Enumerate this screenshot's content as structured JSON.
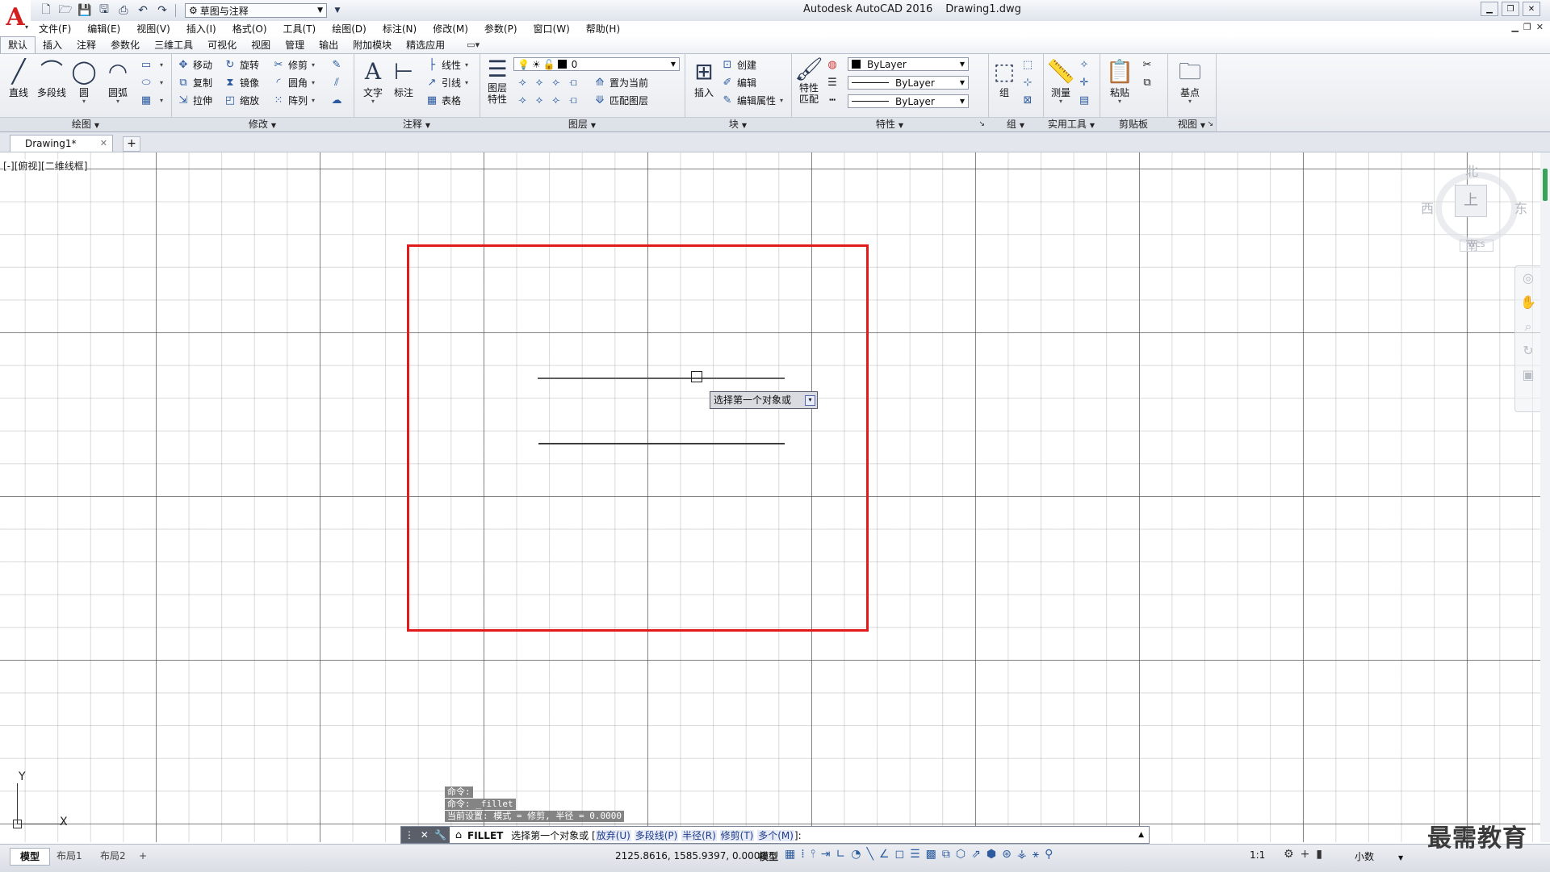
{
  "window": {
    "app_title": "Autodesk AutoCAD 2016",
    "file_title": "Drawing1.dwg"
  },
  "quick_access": {
    "workspace": "草图与注释"
  },
  "menu": [
    "文件(F)",
    "编辑(E)",
    "视图(V)",
    "插入(I)",
    "格式(O)",
    "工具(T)",
    "绘图(D)",
    "标注(N)",
    "修改(M)",
    "参数(P)",
    "窗口(W)",
    "帮助(H)"
  ],
  "ribbon_tabs": [
    "默认",
    "插入",
    "注释",
    "参数化",
    "三维工具",
    "可视化",
    "视图",
    "管理",
    "输出",
    "附加模块",
    "精选应用"
  ],
  "ribbon": {
    "draw": {
      "title": "绘图",
      "line": "直线",
      "polyline": "多段线",
      "circle": "圆",
      "arc": "圆弧"
    },
    "modify": {
      "title": "修改",
      "move": "移动",
      "rotate": "旋转",
      "trim": "修剪",
      "copy": "复制",
      "mirror": "镜像",
      "fillet": "圆角",
      "stretch": "拉伸",
      "scale": "缩放",
      "array": "阵列"
    },
    "annotation": {
      "title": "注释",
      "text": "文字",
      "dimension": "标注",
      "linear": "线性",
      "leader": "引线",
      "table": "表格"
    },
    "layers": {
      "title": "图层",
      "layer_props": "图层",
      "layer_props2": "特性",
      "current_layer": "0",
      "set_current": "置为当前",
      "match_layer": "匹配图层"
    },
    "block": {
      "title": "块",
      "insert": "插入",
      "create": "创建",
      "edit": "编辑",
      "edit_attr": "编辑属性"
    },
    "properties": {
      "title": "特性",
      "match": "特性",
      "match2": "匹配",
      "color": "ByLayer",
      "linetype": "ByLayer",
      "lineweight": "ByLayer"
    },
    "groups": {
      "title": "组",
      "group": "组"
    },
    "utilities": {
      "title": "实用工具",
      "measure": "测量"
    },
    "clipboard": {
      "title": "剪贴板",
      "paste": "粘贴"
    },
    "view": {
      "title": "视图",
      "base": "基点"
    }
  },
  "file_tabs": {
    "doc": "Drawing1*"
  },
  "viewport": {
    "label": "[-][俯视][二维线框]",
    "tooltip": "选择第一个对象或",
    "viewcube": {
      "north": "北",
      "south": "南",
      "east": "东",
      "west": "西",
      "top": "上",
      "wcs": "WCS"
    },
    "ucs": {
      "x": "X",
      "y": "Y"
    }
  },
  "command": {
    "history": [
      "命令:",
      "命令: _fillet",
      "当前设置: 模式 = 修剪, 半径 = 0.0000"
    ],
    "current_cmd": "FILLET",
    "prompt": "选择第一个对象或",
    "options": [
      "放弃(U)",
      "多段线(P)",
      "半径(R)",
      "修剪(T)",
      "多个(M)"
    ],
    "opt_open": "[",
    "opt_close": "]:"
  },
  "status": {
    "layout_tabs": [
      "模型",
      "布局1",
      "布局2"
    ],
    "coords": "2125.8616, 1585.9397, 0.0000",
    "space": "模型",
    "scale": "1:1",
    "units": "小数"
  },
  "watermark": "最需教育",
  "colors": {
    "frame": "#e11b1b",
    "logo": "#d21f1f"
  }
}
